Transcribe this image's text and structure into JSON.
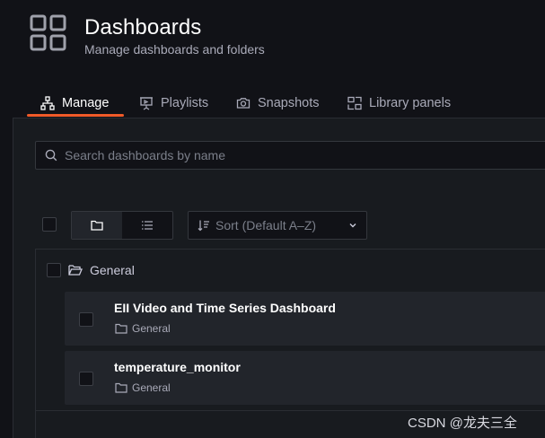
{
  "header": {
    "title": "Dashboards",
    "subtitle": "Manage dashboards and folders"
  },
  "tabs": [
    {
      "label": "Manage",
      "icon": "sitemap-icon",
      "active": true
    },
    {
      "label": "Playlists",
      "icon": "presentation-icon",
      "active": false
    },
    {
      "label": "Snapshots",
      "icon": "camera-icon",
      "active": false
    },
    {
      "label": "Library panels",
      "icon": "library-panels-icon",
      "active": false
    }
  ],
  "search": {
    "placeholder": "Search dashboards by name",
    "value": ""
  },
  "sort": {
    "label": "Sort (Default A–Z)"
  },
  "folder": {
    "name": "General"
  },
  "dashboards": [
    {
      "title": "EII Video and Time Series Dashboard",
      "folder": "General"
    },
    {
      "title": "temperature_monitor",
      "folder": "General"
    }
  ],
  "watermark": "CSDN @龙夫三全",
  "colors": {
    "accent": "#f05a28",
    "background": "#111217",
    "panel": "#181b1f",
    "card": "#22252b"
  }
}
